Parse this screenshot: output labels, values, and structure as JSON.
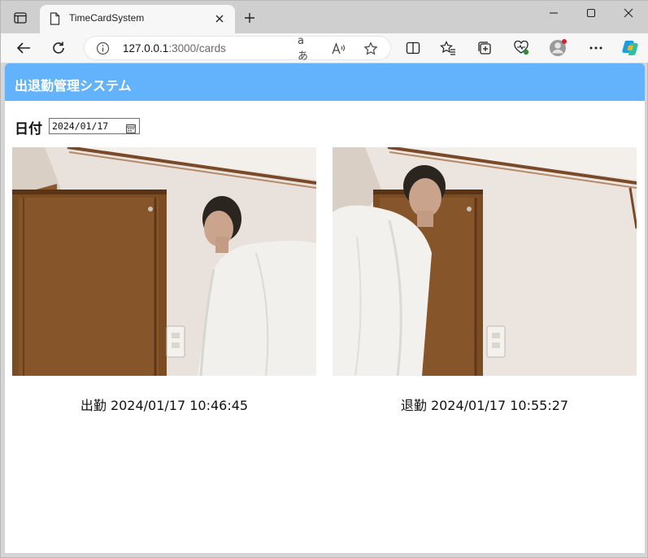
{
  "browser": {
    "tab_title": "TimeCardSystem",
    "url_host": "127.0.0.1",
    "url_path": ":3000/cards",
    "read_aloud_glyph": "Á",
    "translate_glyph": "aあ"
  },
  "app": {
    "title": "出退勤管理システム",
    "date_label": "日付",
    "date_value": "2024/01/17"
  },
  "cards": [
    {
      "type": "出勤",
      "timestamp": "2024/01/17 10:46:45",
      "caption": "出勤 2024/01/17 10:46:45"
    },
    {
      "type": "退勤",
      "timestamp": "2024/01/17 10:55:27",
      "caption": "退勤 2024/01/17 10:55:27"
    }
  ],
  "colors": {
    "header_bg": "#62b3fb",
    "header_text": "#ffffff"
  }
}
